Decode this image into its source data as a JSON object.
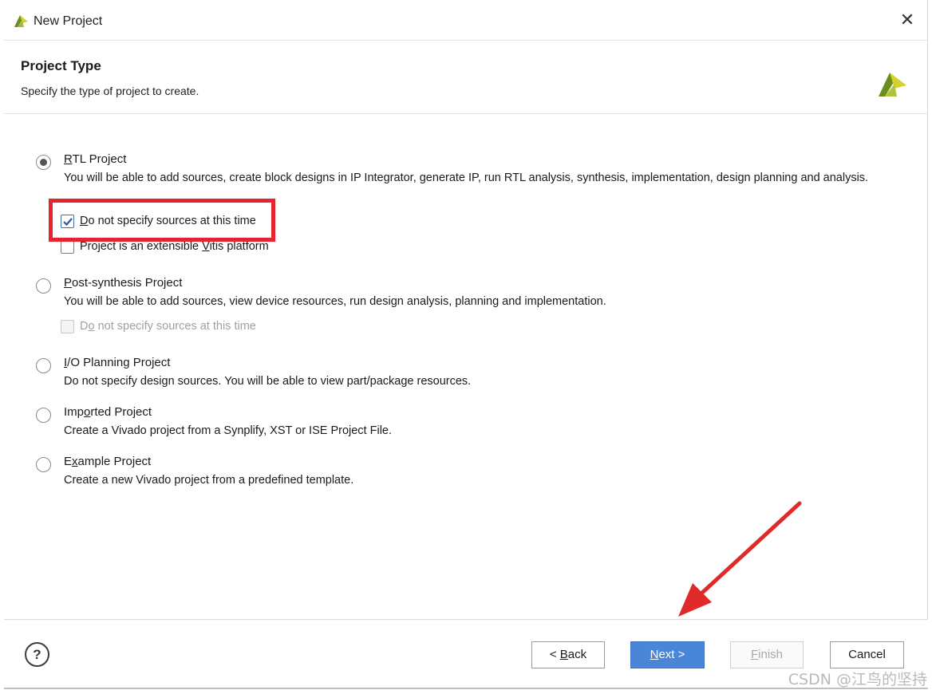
{
  "window": {
    "title": "New Project",
    "close_glyph": "✕"
  },
  "header": {
    "title": "Project Type",
    "subtitle": "Specify the type of project to create."
  },
  "options": [
    {
      "title_accel": "R",
      "title_rest": "TL Project",
      "selected": true,
      "description": "You will be able to add sources, create block designs in IP Integrator, generate IP, run RTL analysis, synthesis, implementation, design planning and analysis.",
      "checkboxes": [
        {
          "accel": "D",
          "rest": "o not specify sources at this time",
          "checked": true,
          "enabled": true
        },
        {
          "pre": "Project is an extensible ",
          "accel": "V",
          "rest": "itis platform",
          "checked": false,
          "enabled": true
        }
      ]
    },
    {
      "title_accel": "P",
      "title_rest": "ost-synthesis Project",
      "selected": false,
      "description": "You will be able to add sources, view device resources, run design analysis, planning and implementation.",
      "checkboxes": [
        {
          "pre": "D",
          "accel": "o",
          "rest": " not specify sources at this time",
          "checked": false,
          "enabled": false
        }
      ]
    },
    {
      "title_accel": "I",
      "title_rest": "/O Planning Project",
      "selected": false,
      "description": "Do not specify design sources. You will be able to view part/package resources."
    },
    {
      "title_pre": "Imp",
      "title_accel": "o",
      "title_rest": "rted Project",
      "selected": false,
      "description": "Create a Vivado project from a Synplify, XST or ISE Project File."
    },
    {
      "title_pre": "E",
      "title_accel": "x",
      "title_rest": "ample Project",
      "selected": false,
      "description": "Create a new Vivado project from a predefined template."
    }
  ],
  "footer": {
    "help_label": "?",
    "back": {
      "pre": "< ",
      "accel": "B",
      "rest": "ack"
    },
    "next": {
      "accel": "N",
      "rest": "ext >"
    },
    "finish": {
      "accel": "F",
      "rest": "inish"
    },
    "cancel": "Cancel"
  },
  "watermark": "CSDN @江鸟的坚持",
  "colors": {
    "accent": "#4a86d8",
    "highlight": "#e8232f",
    "logo_yellow": "#d6d02c",
    "logo_green": "#6b8d1f"
  },
  "icons": {
    "app": "vivado-logo-icon",
    "close": "close-icon",
    "help": "help-icon",
    "annotation_arrow": "red-arrow-icon"
  }
}
